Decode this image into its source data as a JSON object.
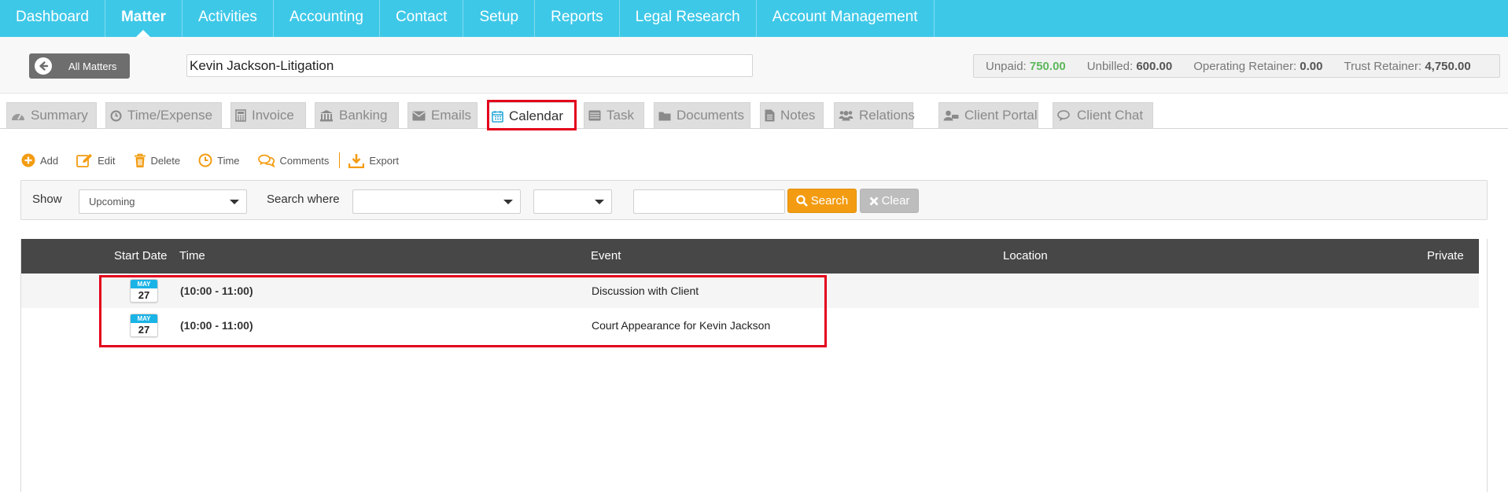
{
  "colors": {
    "nav_bg": "#3ec8e8",
    "accent_orange": "#f39c12",
    "green_amount": "#5cb85c",
    "table_header_bg": "#474747",
    "highlight_red": "#e3001b"
  },
  "topnav": {
    "items": [
      {
        "label": "Dashboard"
      },
      {
        "label": "Matter",
        "active": true
      },
      {
        "label": "Activities"
      },
      {
        "label": "Accounting"
      },
      {
        "label": "Contact"
      },
      {
        "label": "Setup"
      },
      {
        "label": "Reports"
      },
      {
        "label": "Legal Research"
      },
      {
        "label": "Account Management"
      }
    ]
  },
  "header": {
    "back_button": {
      "label": "All Matters",
      "icon": "arrow-left-circle-icon"
    },
    "matter_name": "Kevin Jackson-Litigation",
    "balances": {
      "unpaid_label": "Unpaid:",
      "unpaid_value": "750.00",
      "unbilled_label": "Unbilled:",
      "unbilled_value": "600.00",
      "operating_label": "Operating Retainer:",
      "operating_value": "0.00",
      "trust_label": "Trust Retainer:",
      "trust_value": "4,750.00"
    }
  },
  "tabs": [
    {
      "label": "Summary",
      "icon": "dashboard-icon"
    },
    {
      "label": "Time/Expense",
      "icon": "clock-icon"
    },
    {
      "label": "Invoice",
      "icon": "calculator-icon"
    },
    {
      "label": "Banking",
      "icon": "bank-icon"
    },
    {
      "label": "Emails",
      "icon": "envelope-icon"
    },
    {
      "label": "Calendar",
      "icon": "calendar-icon",
      "active": true
    },
    {
      "label": "Task",
      "icon": "tasks-icon"
    },
    {
      "label": "Documents",
      "icon": "folder-icon"
    },
    {
      "label": "Notes",
      "icon": "file-icon"
    },
    {
      "label": "Relations",
      "icon": "users-icon"
    },
    {
      "label": "Client Portal",
      "icon": "user-portal-icon"
    },
    {
      "label": "Client Chat",
      "icon": "chat-icon"
    }
  ],
  "actions": {
    "add": "Add",
    "edit": "Edit",
    "delete": "Delete",
    "time": "Time",
    "comments": "Comments",
    "export": "Export"
  },
  "filter": {
    "show_label": "Show",
    "show_value": "Upcoming",
    "search_where_label": "Search where",
    "search_field_value": "",
    "operator_value": "",
    "search_text": "",
    "search_button": "Search",
    "clear_button": "Clear"
  },
  "table": {
    "columns": [
      "Start Date",
      "Time",
      "Event",
      "Location",
      "Private"
    ],
    "rows": [
      {
        "month": "MAY",
        "day": "27",
        "time": "(10:00 - 11:00)",
        "event": "Discussion with Client",
        "location": "",
        "private": ""
      },
      {
        "month": "MAY",
        "day": "27",
        "time": "(10:00 - 11:00)",
        "event": "Court Appearance for Kevin Jackson",
        "location": "",
        "private": ""
      }
    ]
  }
}
